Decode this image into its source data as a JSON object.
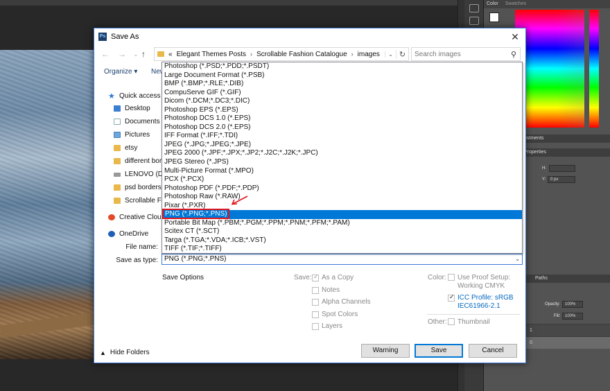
{
  "dialog": {
    "title": "Save As",
    "close_glyph": "✕",
    "breadcrumb": {
      "prefix": "«",
      "items": [
        "Elegant Themes Posts",
        "Scrollable Fashion Catalogue",
        "images"
      ]
    },
    "search_placeholder": "Search images",
    "toolbar": {
      "organize": "Organize ▾",
      "new_folder": "New"
    },
    "nav_pane": [
      {
        "label": "Quick access",
        "icon": "star-icon"
      },
      {
        "label": "Desktop",
        "icon": "desktop-icon"
      },
      {
        "label": "Documents",
        "icon": "documents-icon"
      },
      {
        "label": "Pictures",
        "icon": "pictures-icon"
      },
      {
        "label": "etsy",
        "icon": "folder-icon"
      },
      {
        "label": "different bord",
        "icon": "folder-icon"
      },
      {
        "label": "LENOVO (D:)",
        "icon": "drive-icon"
      },
      {
        "label": "psd borders",
        "icon": "folder-icon"
      },
      {
        "label": "Scrollable Fash",
        "icon": "folder-icon"
      },
      {
        "label": "Creative Cloud",
        "icon": "creative-cloud-icon"
      },
      {
        "label": "OneDrive",
        "icon": "onedrive-icon"
      }
    ],
    "file_name_label": "File name:",
    "save_as_type_label": "Save as type:",
    "save_as_type_value": "PNG (*.PNG;*.PNS)",
    "format_options": [
      "Photoshop (*.PSD;*.PDD;*.PSDT)",
      "Large Document Format (*.PSB)",
      "BMP (*.BMP;*.RLE;*.DIB)",
      "CompuServe GIF (*.GIF)",
      "Dicom (*.DCM;*.DC3;*.DIC)",
      "Photoshop EPS (*.EPS)",
      "Photoshop DCS 1.0 (*.EPS)",
      "Photoshop DCS 2.0 (*.EPS)",
      "IFF Format (*.IFF;*.TDI)",
      "JPEG (*.JPG;*.JPEG;*.JPE)",
      "JPEG 2000 (*.JPF;*.JPX;*.JP2;*.J2C;*.J2K;*.JPC)",
      "JPEG Stereo (*.JPS)",
      "Multi-Picture Format (*.MPO)",
      "PCX (*.PCX)",
      "Photoshop PDF (*.PDF;*.PDP)",
      "Photoshop Raw (*.RAW)",
      "Pixar (*.PXR)",
      "PNG (*.PNG;*.PNS)",
      "Portable Bit Map (*.PBM;*.PGM;*.PPM;*.PNM;*.PFM;*.PAM)",
      "Scitex CT (*.SCT)",
      "Targa (*.TGA;*.VDA;*.ICB;*.VST)",
      "TIFF (*.TIF;*.TIFF)"
    ],
    "selected_index": 17,
    "save_options_label": "Save Options",
    "save_label": "Save:",
    "save_checkboxes": [
      {
        "label": "As a Copy",
        "checked": true
      },
      {
        "label": "Notes",
        "checked": false
      },
      {
        "label": "Alpha Channels",
        "checked": false
      },
      {
        "label": "Spot Colors",
        "checked": false
      },
      {
        "label": "Layers",
        "checked": false
      }
    ],
    "color_label": "Color:",
    "use_proof_line1": "Use Proof Setup:",
    "use_proof_line2": "Working CMYK",
    "icc_line1": "ICC Profile:  sRGB",
    "icc_line2": "IEC61966-2.1",
    "other_label": "Other:",
    "thumbnail_label": "Thumbnail",
    "hide_folders": "Hide Folders",
    "buttons": {
      "warning": "Warning",
      "save": "Save",
      "cancel": "Cancel"
    }
  },
  "photoshop": {
    "tabs": {
      "color": "Color",
      "swatches": "Swatches"
    },
    "adjustments_tab": "ustments",
    "properties_title": "Properties",
    "h_label": "H:",
    "y_label": "Y:",
    "y_value": "0 px",
    "paths_tab": "Paths",
    "opacity_label": "Opacity:",
    "opacity_value": "100%",
    "fill_label": "Fill:",
    "fill_value": "100%",
    "layer_row1": "1",
    "layer_row2": "0"
  }
}
